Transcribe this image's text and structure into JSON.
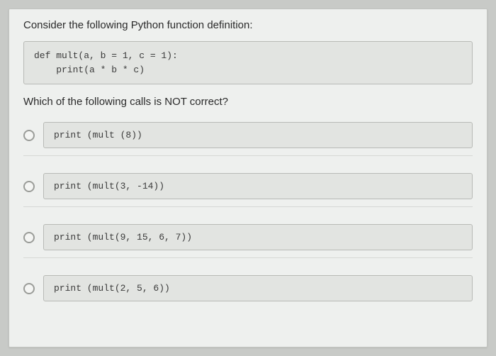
{
  "question": {
    "prompt": "Consider the following Python function definition:",
    "code": "def mult(a, b = 1, c = 1):\n    print(a * b * c)",
    "subprompt": "Which of the following calls is NOT correct?"
  },
  "options": [
    {
      "code": "print (mult (8))"
    },
    {
      "code": "print (mult(3, -14))"
    },
    {
      "code": "print (mult(9, 15, 6, 7))"
    },
    {
      "code": "print (mult(2, 5, 6))"
    }
  ]
}
